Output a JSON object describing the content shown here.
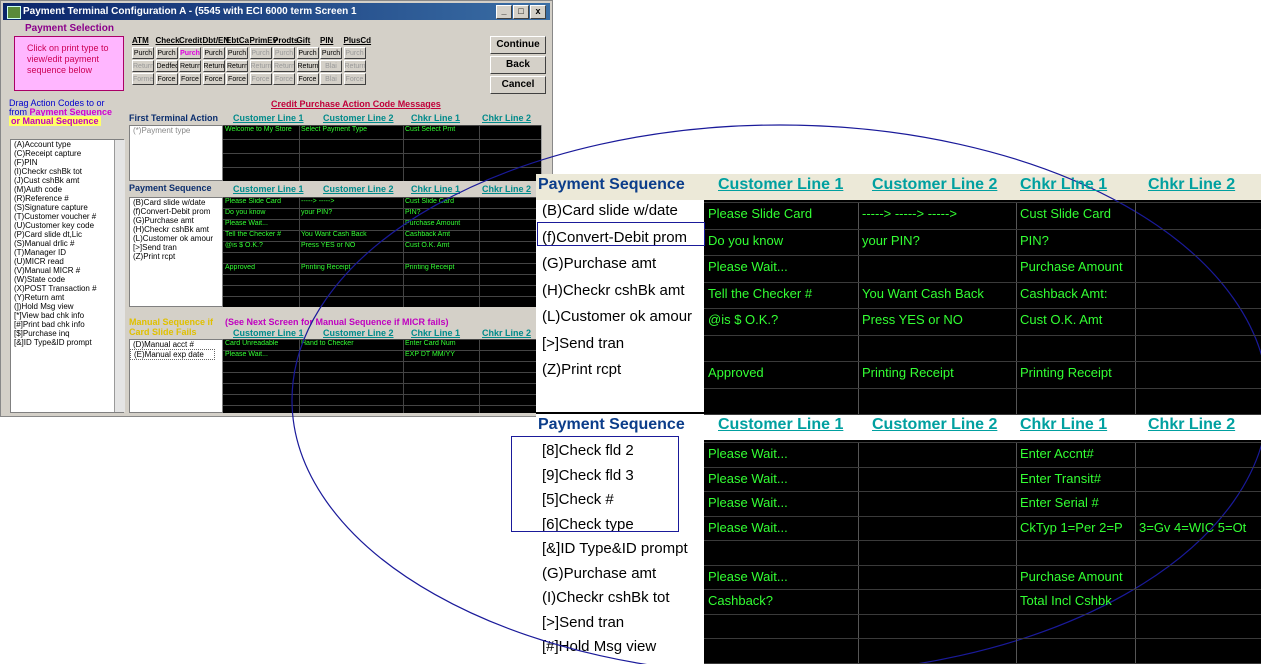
{
  "window": {
    "title": "Payment Terminal Configuration A - (5545 with ECI 6000 term Screen 1",
    "buttons": [
      "_",
      "□",
      "x"
    ]
  },
  "payment_selection": {
    "label": "Payment Selection",
    "hint": "Click on print type to view/edit payment sequence below",
    "types": [
      "ATM",
      "Check",
      "Credit",
      "Dbt/EN",
      "EbtCa",
      "PrimEv",
      "Prodts",
      "Gift",
      "PIN",
      "PlusCd"
    ],
    "row1": [
      "Purch",
      "Purch",
      "Purch",
      "Purch",
      "Purch",
      "Purch",
      "Purch",
      "Purch",
      "Purch",
      "Purch"
    ],
    "row2": [
      "Return",
      "Dedfede",
      "Return",
      "Return",
      "Return",
      "Return",
      "Return",
      "Return",
      "Blai",
      "Return"
    ],
    "row3": [
      "Forme",
      "Force",
      "Force",
      "Force",
      "Force",
      "Force",
      "Force",
      "Force",
      "Blai",
      "Force"
    ]
  },
  "right_buttons": {
    "continue": "Continue",
    "back": "Back",
    "cancel": "Cancel"
  },
  "drag_label": {
    "line1": "Drag Action Codes to or",
    "line2_a": "from",
    "line2_b": "Payment Sequence",
    "line3": "or Manual Sequence"
  },
  "credit_header": "Credit Purchase Action Code Messages",
  "first_action": {
    "label": "First Terminal Action",
    "list": [
      "(*)Payment type"
    ],
    "cols": [
      "Customer Line 1",
      "Customer Line 2",
      "Chkr Line 1",
      "Chkr Line 2"
    ],
    "row": [
      "Welcome to My Store",
      "Select Payment Type",
      "Cust Select Pmt"
    ]
  },
  "action_codes": [
    "(A)Account type",
    "(C)Receipt capture",
    "(F)PIN",
    "(I)Checkr cshBk tot",
    "(J)Cust cshBk amt",
    "(M)Auth code",
    "(R)Reference #",
    "(S)Signature capture",
    "(T)Customer voucher #",
    "(U)Customer key code",
    "(P)Card slide dt,Lic",
    "(S)Manual drlic #",
    "(T)Manager ID",
    "(U)MICR read",
    "(V)Manual MICR #",
    "(W)State code",
    "(X)POST Transaction #",
    "(Y)Return amt",
    "(])Hold Msg view",
    "[*]View bad chk info",
    "[#]Print bad chk info",
    "[$]Purchase inq",
    "[&]ID Type&ID prompt"
  ],
  "small_seq": {
    "label": "Payment Sequence",
    "cols": [
      "Customer Line 1",
      "Customer Line 2",
      "Chkr Line 1",
      "Chkr Line 2"
    ],
    "items": [
      "(B)Card slide w/date",
      "(f)Convert-Debit prom",
      "(G)Purchase amt",
      "(H)Checkr cshBk amt",
      "(L)Customer ok amour",
      "[>]Send tran",
      "(Z)Print rcpt"
    ],
    "rows": [
      [
        "Please Slide Card",
        "-----> ----->",
        "Cust Slide Card"
      ],
      [
        "Do you know",
        "your PIN?",
        "PIN?"
      ],
      [
        "Please Wait...",
        "",
        "Purchase Amount"
      ],
      [
        "Tell the Checker #",
        "You Want Cash Back",
        "Cashback Amt"
      ],
      [
        "@is $ O.K.?",
        "Press YES or NO",
        "Cust O.K. Amt"
      ],
      [
        "",
        "",
        ""
      ],
      [
        "Approved",
        "Printing Receipt",
        "Printing Receipt"
      ]
    ]
  },
  "manual_seq": {
    "label_a": "Manual Sequence if",
    "label_b": "(See Next Screen for Manual Sequence if MICR fails)",
    "label_c": "Card Slide Fails",
    "cols": [
      "Customer Line 1",
      "Customer Line 2",
      "Chkr Line 1",
      "Chkr Line 2"
    ],
    "items": [
      "(D)Manual acct #",
      "(E)Manual exp date"
    ],
    "rows": [
      [
        "Card Unreadable",
        "Hand to Checker",
        "Enter Card Num"
      ],
      [
        "Please Wait...",
        "",
        "EXP DT MM/YY"
      ]
    ]
  },
  "zoom1": {
    "title": "Payment Sequence",
    "cols": [
      "Customer Line 1",
      "Customer Line 2",
      "Chkr Line 1",
      "Chkr Line 2"
    ],
    "items": [
      "(B)Card slide w/date",
      "(f)Convert-Debit prom",
      "(G)Purchase amt",
      "(H)Checkr cshBk amt",
      "(L)Customer ok amour",
      "[>]Send tran",
      "(Z)Print rcpt"
    ],
    "rows": [
      [
        "Please Slide Card",
        "-----> -----> ----->",
        "Cust Slide Card",
        ""
      ],
      [
        "Do you know",
        "your PIN?",
        "PIN?",
        ""
      ],
      [
        "Please Wait...",
        "",
        "Purchase Amount",
        ""
      ],
      [
        "Tell the Checker #",
        "You Want Cash Back",
        "Cashback Amt:",
        ""
      ],
      [
        "@is $ O.K.?",
        "Press YES or NO",
        "Cust O.K. Amt",
        ""
      ],
      [
        "",
        "",
        "",
        ""
      ],
      [
        "Approved",
        "Printing Receipt",
        "Printing Receipt",
        ""
      ],
      [
        "",
        "",
        "",
        ""
      ]
    ]
  },
  "zoom2": {
    "title": "Payment Sequence",
    "cols": [
      "Customer Line 1",
      "Customer Line 2",
      "Chkr Line 1",
      "Chkr Line 2"
    ],
    "items": [
      "[8]Check fld 2",
      "[9]Check fld 3",
      "[5]Check #",
      "[6]Check type",
      "[&]ID Type&ID prompt",
      "(G)Purchase amt",
      "(I)Checkr cshBk tot",
      "[>]Send tran",
      "[#]Hold Msg view"
    ],
    "rows": [
      [
        "Please Wait...",
        "",
        "Enter Accnt#",
        ""
      ],
      [
        "Please Wait...",
        "",
        "Enter Transit#",
        ""
      ],
      [
        "Please Wait...",
        "",
        "Enter Serial #",
        ""
      ],
      [
        "Please Wait...",
        "",
        "CkTyp 1=Per 2=P",
        "3=Gv 4=WIC 5=Ot"
      ],
      [
        "",
        "",
        "",
        ""
      ],
      [
        "Please Wait...",
        "",
        "Purchase Amount",
        ""
      ],
      [
        "Cashback?",
        "",
        "Total Incl Cshbk",
        ""
      ],
      [
        "",
        "",
        "",
        ""
      ],
      [
        "",
        "",
        "",
        ""
      ]
    ]
  },
  "colors": {
    "grid_bg": "#000000",
    "grid_text": "#33ff33",
    "header_teal": "#00a0a0",
    "header_blue": "#0b3d8a",
    "annotation": "#1a1a9a"
  }
}
